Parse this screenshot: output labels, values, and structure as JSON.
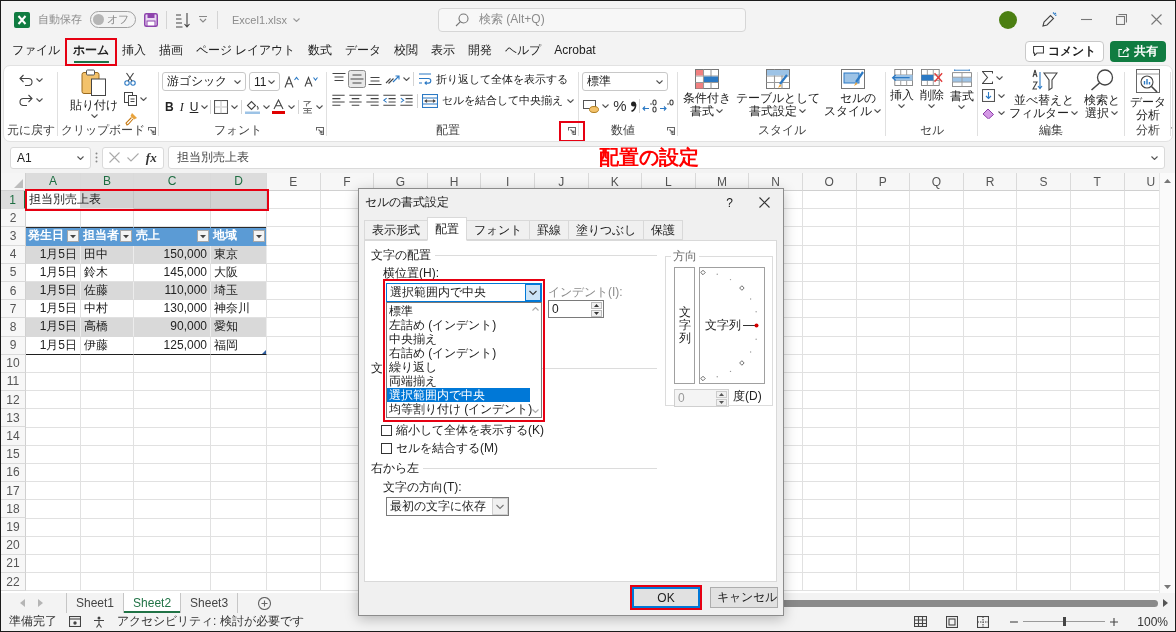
{
  "title_bar": {
    "autosave_label": "自動保存",
    "autosave": {
      "label": "オフ",
      "on": false
    },
    "filename": "Excel1.xlsx",
    "search": {
      "placeholder": "検索 (Alt+Q)"
    }
  },
  "menu_tabs": [
    {
      "label": "ファイル",
      "selected": false,
      "highlighted": false
    },
    {
      "label": "ホーム",
      "selected": true,
      "highlighted": true
    },
    {
      "label": "挿入",
      "selected": false,
      "highlighted": false
    },
    {
      "label": "描画",
      "selected": false,
      "highlighted": false
    },
    {
      "label": "ページ レイアウト",
      "selected": false,
      "highlighted": false
    },
    {
      "label": "数式",
      "selected": false,
      "highlighted": false
    },
    {
      "label": "データ",
      "selected": false,
      "highlighted": false
    },
    {
      "label": "校閲",
      "selected": false,
      "highlighted": false
    },
    {
      "label": "表示",
      "selected": false,
      "highlighted": false
    },
    {
      "label": "開発",
      "selected": false,
      "highlighted": false
    },
    {
      "label": "ヘルプ",
      "selected": false,
      "highlighted": false
    },
    {
      "label": "Acrobat",
      "selected": false,
      "highlighted": false
    }
  ],
  "header_buttons": {
    "comment": "コメント",
    "share": "共有"
  },
  "ribbon": {
    "undo": {
      "label": "元に戻す"
    },
    "clipboard": {
      "label": "クリップボード",
      "paste": "貼り付け"
    },
    "font": {
      "label": "フォント",
      "font_name": "游ゴシック",
      "font_size": "11",
      "style_buttons": [
        "B",
        "I",
        "U"
      ]
    },
    "alignment": {
      "label": "配置",
      "vertical_align": [
        {
          "selected": false
        },
        {
          "selected": true
        },
        {
          "selected": false
        }
      ],
      "wrap_text": "折り返して全体を表示する",
      "merge_center": "セルを結合して中央揃え",
      "launcher_highlighted": true
    },
    "number": {
      "label": "数値",
      "format": "標準",
      "percent": "%"
    },
    "styles": {
      "label": "スタイル",
      "buttons": [
        "条件付き書式",
        "テーブルとして書式設定",
        "セルのスタイル"
      ]
    },
    "cells": {
      "label": "セル",
      "buttons": [
        "挿入",
        "削除",
        "書式"
      ]
    },
    "editing": {
      "label": "編集",
      "buttons": [
        "並べ替えとフィルター",
        "検索と選択"
      ]
    },
    "analysis": {
      "label": "分析",
      "buttons": [
        "データ分析"
      ]
    }
  },
  "annotation": {
    "text": "配置の設定"
  },
  "formula_bar": {
    "name_box": "A1",
    "function_button": "fx",
    "value": "担当別売上表"
  },
  "sheet": {
    "columns": [
      {
        "label": "A",
        "selected": true
      },
      {
        "label": "B",
        "selected": true
      },
      {
        "label": "C",
        "selected": true
      },
      {
        "label": "D",
        "selected": true
      },
      {
        "label": "E",
        "selected": false
      },
      {
        "label": "F",
        "selected": false
      },
      {
        "label": "G",
        "selected": false
      },
      {
        "label": "H",
        "selected": false
      },
      {
        "label": "I",
        "selected": false
      },
      {
        "label": "J",
        "selected": false
      },
      {
        "label": "K",
        "selected": false
      },
      {
        "label": "L",
        "selected": false
      },
      {
        "label": "M",
        "selected": false
      },
      {
        "label": "N",
        "selected": false
      },
      {
        "label": "O",
        "selected": false
      },
      {
        "label": "P",
        "selected": false
      },
      {
        "label": "Q",
        "selected": false
      },
      {
        "label": "R",
        "selected": false
      },
      {
        "label": "S",
        "selected": false
      },
      {
        "label": "T",
        "selected": false
      },
      {
        "label": "U",
        "selected": false
      }
    ],
    "rows": [
      {
        "label": "1",
        "selected": true
      },
      {
        "label": "2",
        "selected": false
      },
      {
        "label": "3",
        "selected": false
      },
      {
        "label": "4",
        "selected": false
      },
      {
        "label": "5",
        "selected": false
      },
      {
        "label": "6",
        "selected": false
      },
      {
        "label": "7",
        "selected": false
      },
      {
        "label": "8",
        "selected": false
      },
      {
        "label": "9",
        "selected": false
      },
      {
        "label": "10",
        "selected": false
      },
      {
        "label": "11",
        "selected": false
      },
      {
        "label": "12",
        "selected": false
      },
      {
        "label": "13",
        "selected": false
      },
      {
        "label": "14",
        "selected": false
      },
      {
        "label": "15",
        "selected": false
      },
      {
        "label": "16",
        "selected": false
      },
      {
        "label": "17",
        "selected": false
      },
      {
        "label": "18",
        "selected": false
      },
      {
        "label": "19",
        "selected": false
      },
      {
        "label": "20",
        "selected": false
      },
      {
        "label": "21",
        "selected": false
      },
      {
        "label": "22",
        "selected": false
      }
    ],
    "title": "担当別売上表",
    "title_highlighted": true,
    "table": {
      "headers": [
        "発生日",
        "担当者",
        "売上",
        "地域"
      ],
      "rows": [
        [
          "1月5日",
          "田中",
          "150,000",
          "東京"
        ],
        [
          "1月5日",
          "鈴木",
          "145,000",
          "大阪"
        ],
        [
          "1月5日",
          "佐藤",
          "110,000",
          "埼玉"
        ],
        [
          "1月5日",
          "中村",
          "130,000",
          "神奈川"
        ],
        [
          "1月5日",
          "高橋",
          "90,000",
          "愛知"
        ],
        [
          "1月5日",
          "伊藤",
          "125,000",
          "福岡"
        ]
      ]
    }
  },
  "sheet_tabs": [
    {
      "label": "Sheet1",
      "selected": false
    },
    {
      "label": "Sheet2",
      "selected": true
    },
    {
      "label": "Sheet3",
      "selected": false
    }
  ],
  "status_bar": {
    "ready": "準備完了",
    "accessibility": "アクセシビリティ: 検討が必要です",
    "zoom": {
      "level": 0.5,
      "reading": "100%"
    }
  },
  "dialog": {
    "title": "セルの書式設定",
    "help": "?",
    "tabs": [
      {
        "label": "表示形式",
        "selected": false
      },
      {
        "label": "配置",
        "selected": true
      },
      {
        "label": "フォント",
        "selected": false
      },
      {
        "label": "罫線",
        "selected": false
      },
      {
        "label": "塗りつぶし",
        "selected": false
      },
      {
        "label": "保護",
        "selected": false
      }
    ],
    "text_alignment": {
      "title": "文字の配置",
      "horizontal": {
        "label": "横位置(H):",
        "value": "選択範囲内で中央",
        "expanded": true,
        "highlighted": true,
        "options": [
          {
            "label": "標準",
            "selected": false
          },
          {
            "label": "左詰め (インデント)",
            "selected": false
          },
          {
            "label": "中央揃え",
            "selected": false
          },
          {
            "label": "右詰め (インデント)",
            "selected": false
          },
          {
            "label": "繰り返し",
            "selected": false
          },
          {
            "label": "両端揃え",
            "selected": false
          },
          {
            "label": "選択範囲内で中央",
            "selected": true
          },
          {
            "label": "均等割り付け (インデント)",
            "selected": false
          }
        ]
      },
      "indent": {
        "label": "インデント(I):",
        "value": "0",
        "disabled": true
      }
    },
    "text_control": {
      "title": "文",
      "checkboxes": [
        {
          "label": "縮小して全体を表示する(K)",
          "checked": false
        },
        {
          "label": "セルを結合する(M)",
          "checked": false
        }
      ]
    },
    "right_to_left": {
      "title": "右から左",
      "direction": {
        "label": "文字の方向(T):",
        "value": "最初の文字に依存"
      }
    },
    "orientation": {
      "title": "方向",
      "vertical_text": "文字列",
      "dial_text": "文字列",
      "degrees": {
        "value": "0",
        "label": "度(D)",
        "disabled": true
      }
    },
    "buttons": [
      {
        "label": "OK",
        "primary": true,
        "highlighted": true
      },
      {
        "label": "キャンセル",
        "primary": false,
        "highlighted": false
      }
    ]
  }
}
